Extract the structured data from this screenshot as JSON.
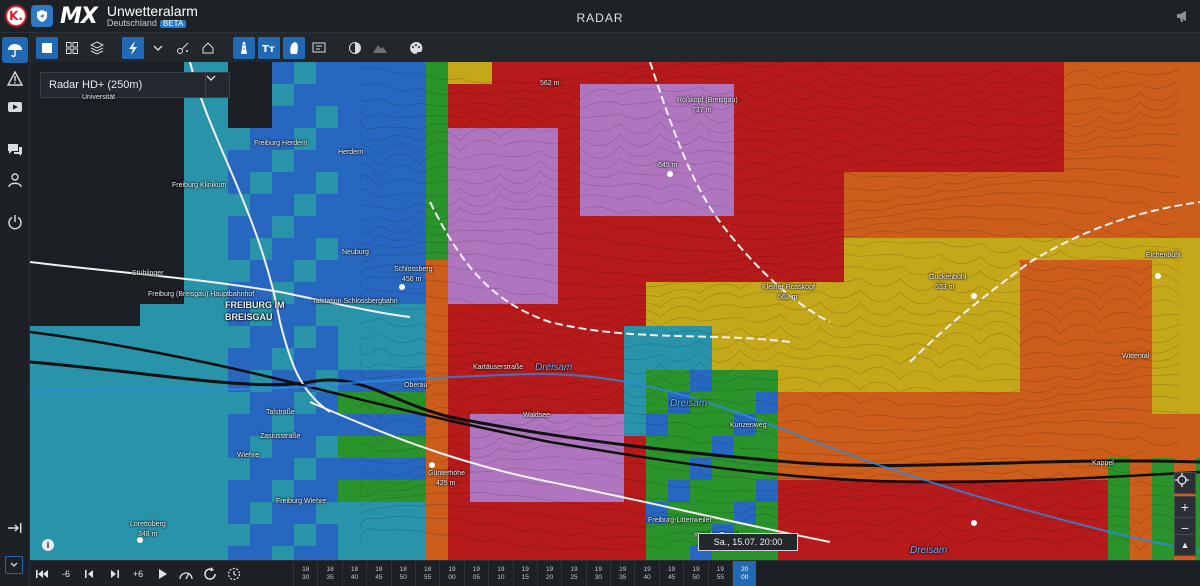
{
  "header": {
    "logo_k": "K.",
    "logo_mx": "MX",
    "title": "Unwetteralarm",
    "subtitle": "Deutschland",
    "badge": "BETA",
    "section": "RADAR"
  },
  "sidebar": {
    "items": [
      "umbrella-icon",
      "warning-icon",
      "video-icon",
      "chat-icon",
      "user-icon",
      "power-icon",
      "login-icon",
      "collapse-icon"
    ]
  },
  "toolbar": {
    "items": [
      "square-icon",
      "grid-icon",
      "layers-icon",
      "lightning-icon",
      "chevron-down-icon",
      "hail-icon",
      "house-icon",
      "road-icon",
      "text-icon",
      "contour-icon",
      "comment-icon",
      "contrast-icon",
      "terrain-icon",
      "palette-icon"
    ]
  },
  "map": {
    "layer_select": "Radar HD+ (250m)",
    "labels": [
      {
        "text": "Universität",
        "cls": ""
      },
      {
        "text": "Freiburg Herdern",
        "cls": ""
      },
      {
        "text": "Herdern",
        "cls": ""
      },
      {
        "text": "Roßkopf (Breisgau)",
        "cls": ""
      },
      {
        "text": "737 m",
        "cls": ""
      },
      {
        "text": "562 m",
        "cls": ""
      },
      {
        "text": "645 m",
        "cls": ""
      },
      {
        "text": "Freiburg Klinikum",
        "cls": ""
      },
      {
        "text": "Neuburg",
        "cls": ""
      },
      {
        "text": "Stühlinger",
        "cls": ""
      },
      {
        "text": "Schlossberg",
        "cls": ""
      },
      {
        "text": "456 m",
        "cls": ""
      },
      {
        "text": "Freiburg (Breisgau) Hauptbahnhof",
        "cls": ""
      },
      {
        "text": "FREIBURG IM",
        "cls": "city"
      },
      {
        "text": "BREISGAU",
        "cls": "city"
      },
      {
        "text": "Talstation Schlossbergbahn",
        "cls": ""
      },
      {
        "text": "Kleiner Rosskopf",
        "cls": ""
      },
      {
        "text": "562 m",
        "cls": ""
      },
      {
        "text": "Guckenbühl",
        "cls": ""
      },
      {
        "text": "533 m",
        "cls": ""
      },
      {
        "text": "Eichenbühl",
        "cls": ""
      },
      {
        "text": "Wittental",
        "cls": ""
      },
      {
        "text": "Oberau",
        "cls": ""
      },
      {
        "text": "Kartäuserstraße",
        "cls": ""
      },
      {
        "text": "Dreisam",
        "cls": "river"
      },
      {
        "text": "Talstraße",
        "cls": ""
      },
      {
        "text": "Zasiusstraße",
        "cls": ""
      },
      {
        "text": "Wiehre",
        "cls": ""
      },
      {
        "text": "Günterhöhe",
        "cls": ""
      },
      {
        "text": "425 m",
        "cls": ""
      },
      {
        "text": "Freiburg Wiehre",
        "cls": ""
      },
      {
        "text": "Lorettoberg",
        "cls": ""
      },
      {
        "text": "348 m",
        "cls": ""
      },
      {
        "text": "Freiburg-Littenweiler",
        "cls": ""
      },
      {
        "text": "Kappler Tunnel",
        "cls": ""
      },
      {
        "text": "Dreisam",
        "cls": "river"
      },
      {
        "text": "Dreisam",
        "cls": "river"
      },
      {
        "text": "Waldsee",
        "cls": ""
      },
      {
        "text": "Kunzenweg",
        "cls": ""
      },
      {
        "text": "Kappel",
        "cls": ""
      }
    ],
    "time_popup": "Sa., 15.07. 20:00",
    "info": "i",
    "zoom_in": "+",
    "zoom_out": "−",
    "compass": "▲"
  },
  "timeline": {
    "step_back": "-6",
    "step_forward": "+6",
    "ticks": [
      {
        "h": "18",
        "m": "30"
      },
      {
        "h": "18",
        "m": "35"
      },
      {
        "h": "18",
        "m": "40"
      },
      {
        "h": "18",
        "m": "45"
      },
      {
        "h": "18",
        "m": "50"
      },
      {
        "h": "18",
        "m": "55"
      },
      {
        "h": "19",
        "m": "00"
      },
      {
        "h": "19",
        "m": "05"
      },
      {
        "h": "19",
        "m": "10"
      },
      {
        "h": "19",
        "m": "15"
      },
      {
        "h": "19",
        "m": "20"
      },
      {
        "h": "19",
        "m": "25"
      },
      {
        "h": "19",
        "m": "30"
      },
      {
        "h": "19",
        "m": "35"
      },
      {
        "h": "19",
        "m": "40"
      },
      {
        "h": "19",
        "m": "45"
      },
      {
        "h": "19",
        "m": "50"
      },
      {
        "h": "19",
        "m": "55"
      },
      {
        "h": "20",
        "m": "00"
      }
    ],
    "selected_index": 18
  },
  "colors": {
    "accent": "#2269b4",
    "header_bg": "#1e2226",
    "radar_red": "#c81a1a",
    "radar_orange": "#e0641a",
    "radar_yellow": "#d8b61a",
    "radar_green": "#2ea02e",
    "radar_blue": "#2a6fd0",
    "radar_cyan": "#2aa0b8",
    "radar_violet": "#c080d0"
  }
}
